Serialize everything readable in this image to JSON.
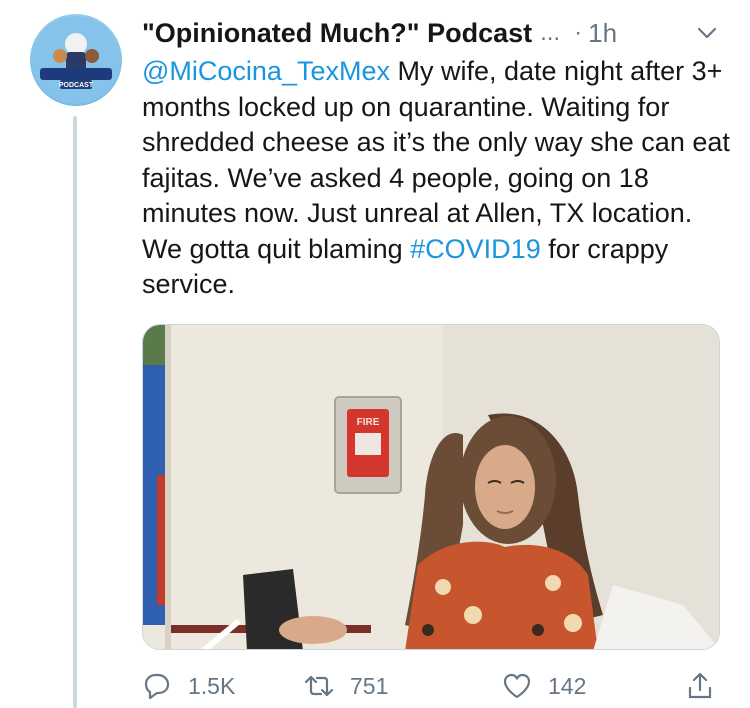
{
  "tweet": {
    "display_name": "\"Opinionated Much?\" Podcast",
    "name_truncation": "...",
    "separator": "·",
    "time": "1h",
    "mention": "@MiCocina_TexMex",
    "text_main": " My wife, date night after 3+ months locked up on quarantine. Waiting for shredded cheese as it’s the only way she can eat fajitas. We’ve asked 4 people, going on 18 minutes now. Just unreal at Allen, TX location. We gotta quit blaming ",
    "hashtag": "#COVID19",
    "text_end": " for crappy service.",
    "avatar": {
      "icon": "podcast-logo-avatar",
      "badge_text": "PODCAST"
    },
    "media": {
      "icon": "photo",
      "sign_text": "FIRE"
    }
  },
  "actions": {
    "reply": {
      "icon": "reply-icon",
      "count": "1.5K"
    },
    "retweet": {
      "icon": "retweet-icon",
      "count": "751"
    },
    "like": {
      "icon": "heart-icon",
      "count": "142"
    },
    "share": {
      "icon": "share-icon"
    }
  },
  "colors": {
    "link": "#1b95e0",
    "text": "#14171a",
    "secondary": "#657786",
    "thread_line": "#ccd6dd"
  }
}
